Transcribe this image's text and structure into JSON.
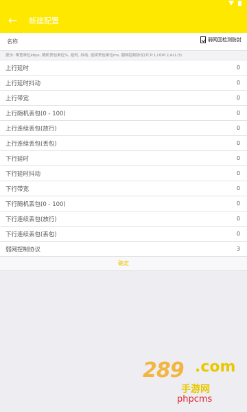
{
  "toolbar": {
    "title": "新建配置",
    "back_icon": "arrow-left-icon"
  },
  "name_row": {
    "label": "名称",
    "checkbox_label": "弱网回检测防封"
  },
  "hint": "提示: 带宽单位kbps, 随机丢包单位%, 延时, 抖动, 连续丢包单位ms, 弱网控制协议(TCP:1,UDP:2,ALL:3)",
  "rows": [
    {
      "label": "上行延时",
      "value": "0"
    },
    {
      "label": "上行延时抖动",
      "value": "0"
    },
    {
      "label": "上行带宽",
      "value": "0"
    },
    {
      "label": "上行随机丢包(0 - 100)",
      "value": "0"
    },
    {
      "label": "上行连续丢包(放行)",
      "value": "0"
    },
    {
      "label": "上行连续丢包(丢包)",
      "value": "0"
    },
    {
      "label": "下行延时",
      "value": "0"
    },
    {
      "label": "下行延时抖动",
      "value": "0"
    },
    {
      "label": "下行带宽",
      "value": "0"
    },
    {
      "label": "下行随机丢包(0 - 100)",
      "value": "0"
    },
    {
      "label": "下行连续丢包(放行)",
      "value": "0"
    },
    {
      "label": "下行连续丢包(丢包)",
      "value": "0"
    },
    {
      "label": "弱网控制协议",
      "value": "3"
    }
  ],
  "confirm_label": "确定",
  "watermark": {
    "number": "289",
    "suffix": ".com",
    "sub": "手游网"
  },
  "footer_mark": "phpcms",
  "colors": {
    "accent": "#ffe800",
    "confirm_text": "#e8c800",
    "footer_mark": "#e0222f"
  }
}
